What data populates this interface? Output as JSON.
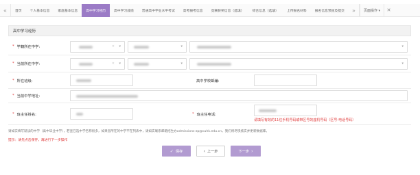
{
  "tabs": {
    "prev_arrow": "«",
    "items": [
      {
        "label": "首页"
      },
      {
        "label": "个人基本信息"
      },
      {
        "label": "家庭基本信息"
      },
      {
        "label": "高中学习经历"
      },
      {
        "label": "高中学习成绩"
      },
      {
        "label": "普通高中学业水平考试"
      },
      {
        "label": "高考报考信息"
      },
      {
        "label": "竞赛获奖信息（选填）"
      },
      {
        "label": "综合信息（选填）"
      },
      {
        "label": "上传报名材料"
      },
      {
        "label": "报名信息预览及提交"
      }
    ],
    "active_index": 3,
    "next_arrow": "»",
    "more_label": "页面操作 ▾",
    "close_label": "✕"
  },
  "section": {
    "title": "高中学习经历"
  },
  "form": {
    "school_province_label": "学籍所在中学:",
    "current_school_label": "当前所在中学:",
    "class_label": "所在班级:",
    "postcode_label": "高中学校邮编:",
    "address_label": "当前中学地址:",
    "teacher_name_label": "班主任姓名:",
    "teacher_phone_label": "班主任电话:",
    "teacher_phone_error": "请填写有效的11位手机号码或带区号的座机号码（区号-电话号码）",
    "required_mark": "*"
  },
  "note": "请如实填写就读的中学（高中毕业中学），若查已选中学名称很多，如果您所在的中学不在列表中，请如实联系邮箱招生办admissions-zp@cuhk.edu.cn，我们将尽快核实并更新数据库。",
  "tip": "提示：请先点击保存，再进行下一步操作",
  "buttons": {
    "save": "保存",
    "prev": "上一步",
    "next": "下一步"
  },
  "colors": {
    "accent": "#9b7bc6",
    "button": "#b29bd1",
    "required": "#e03b3b"
  }
}
